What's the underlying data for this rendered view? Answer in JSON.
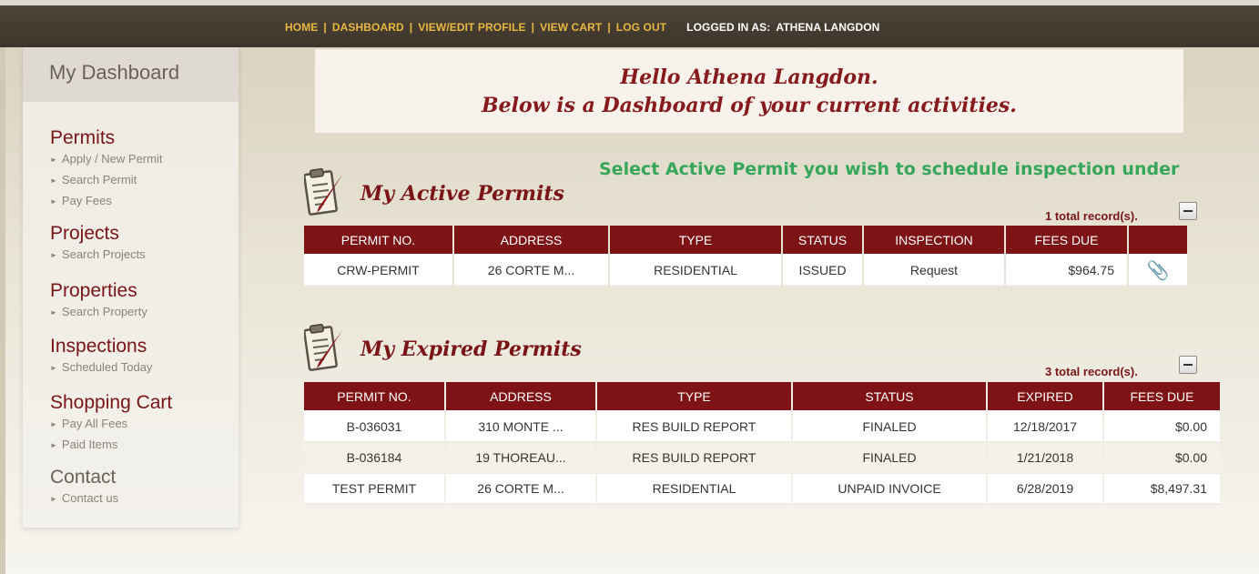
{
  "topnav": {
    "home": "HOME",
    "dashboard": "DASHBOARD",
    "profile": "VIEW/EDIT PROFILE",
    "cart": "VIEW CART",
    "logout": "LOG OUT",
    "separator": "|",
    "logged_in_label": "LOGGED IN AS:",
    "user_name": "ATHENA LANGDON"
  },
  "sidebar": {
    "title": "My Dashboard",
    "sections": [
      {
        "title": "Permits",
        "items": [
          "Apply / New Permit",
          "Search Permit",
          "Pay Fees"
        ]
      },
      {
        "title": "Projects",
        "items": [
          "Search Projects"
        ]
      },
      {
        "title": "Properties",
        "items": [
          "Search Property"
        ]
      },
      {
        "title": "Inspections",
        "items": [
          "Scheduled Today"
        ]
      },
      {
        "title": "Shopping Cart",
        "items": [
          "Pay All Fees",
          "Paid Items"
        ]
      },
      {
        "title": "Contact",
        "items": [
          "Contact us"
        ]
      }
    ]
  },
  "greeting": {
    "line1": "Hello Athena Langdon.",
    "line2": "Below is a Dashboard of your current activities."
  },
  "hint": "Select Active Permit you wish to schedule inspection under",
  "active": {
    "title": "My Active Permits",
    "record_count": "1 total record(s).",
    "columns": [
      "PERMIT NO.",
      "ADDRESS",
      "TYPE",
      "STATUS",
      "INSPECTION",
      "FEES DUE",
      ""
    ],
    "rows": [
      {
        "permit": "CRW-PERMIT",
        "address": "26 CORTE M...",
        "type": "RESIDENTIAL",
        "status": "ISSUED",
        "inspection": "Request",
        "fees": "$964.75"
      }
    ]
  },
  "expired": {
    "title": "My Expired Permits",
    "record_count": "3 total record(s).",
    "columns": [
      "PERMIT NO.",
      "ADDRESS",
      "TYPE",
      "STATUS",
      "EXPIRED",
      "FEES DUE"
    ],
    "rows": [
      {
        "permit": "B-036031",
        "address": "310 MONTE ...",
        "type": "RES BUILD REPORT",
        "status": "FINALED",
        "expired": "12/18/2017",
        "fees": "$0.00"
      },
      {
        "permit": "B-036184",
        "address": "19 THOREAU...",
        "type": "RES BUILD REPORT",
        "status": "FINALED",
        "expired": "1/21/2018",
        "fees": "$0.00"
      },
      {
        "permit": "TEST PERMIT",
        "address": "26 CORTE M...",
        "type": "RESIDENTIAL",
        "status": "UNPAID INVOICE",
        "expired": "6/28/2019",
        "fees": "$8,497.31"
      }
    ]
  },
  "icons": {
    "clipboard": "clipboard-icon",
    "attachment": "paperclip-icon",
    "collapse": "collapse-icon",
    "bullet": "triangle-bullet-icon"
  },
  "colors": {
    "accent": "#7d1315",
    "hint": "#36a65a",
    "nav_link": "#e8b840",
    "topbar": "#3d352b"
  }
}
